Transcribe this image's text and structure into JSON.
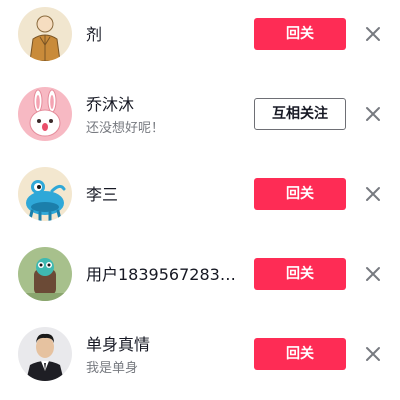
{
  "rows": [
    {
      "name": "剂",
      "subtitle": "",
      "button": "回关",
      "button_style": "follow",
      "avatar": "avatar-sketch-person"
    },
    {
      "name": "乔沐沐",
      "subtitle": "还没想好呢！",
      "button": "互相关注",
      "button_style": "mutual",
      "avatar": "avatar-pink-bunny"
    },
    {
      "name": "李三",
      "subtitle": "",
      "button": "回关",
      "button_style": "follow",
      "avatar": "avatar-blue-monster"
    },
    {
      "name": "用户18395672834…",
      "subtitle": "",
      "button": "回关",
      "button_style": "follow",
      "avatar": "avatar-green-monster"
    },
    {
      "name": "单身真情",
      "subtitle": "我是单身",
      "button": "回关",
      "button_style": "follow",
      "avatar": "avatar-man-suit"
    }
  ],
  "colors": {
    "accent": "#fe2c55",
    "text": "#161823",
    "subtext": "#777a80",
    "close_icon": "#777a80"
  },
  "icons": {
    "close": "close-icon"
  }
}
